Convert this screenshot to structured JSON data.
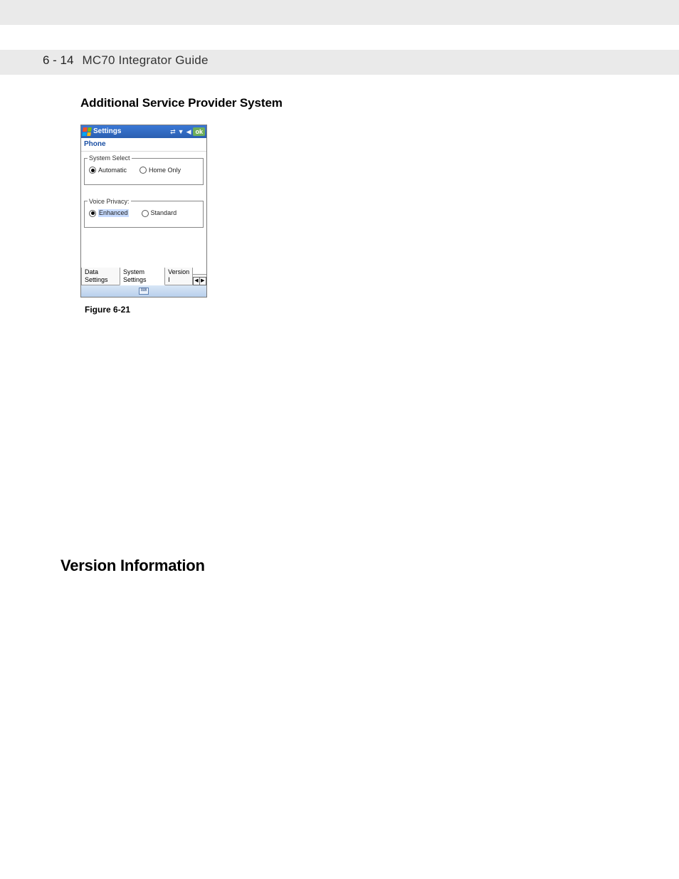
{
  "header": {
    "page_num": "6 - 14",
    "guide_title": "MC70 Integrator Guide"
  },
  "section1_title": "Additional Service Provider System",
  "figure": {
    "caption": "Figure 6-21",
    "titlebar": "Settings",
    "ok": "ok",
    "sub_title": "Phone",
    "group1": {
      "legend": "System Select",
      "opt_a": "Automatic",
      "opt_b": "Home Only"
    },
    "group2": {
      "legend": "Voice Privacy:",
      "opt_a": "Enhanced",
      "opt_b": "Standard"
    },
    "tabs": {
      "a": "Data Settings",
      "b": "System Settings",
      "c": "Version I"
    }
  },
  "section2_title": "Version Information"
}
